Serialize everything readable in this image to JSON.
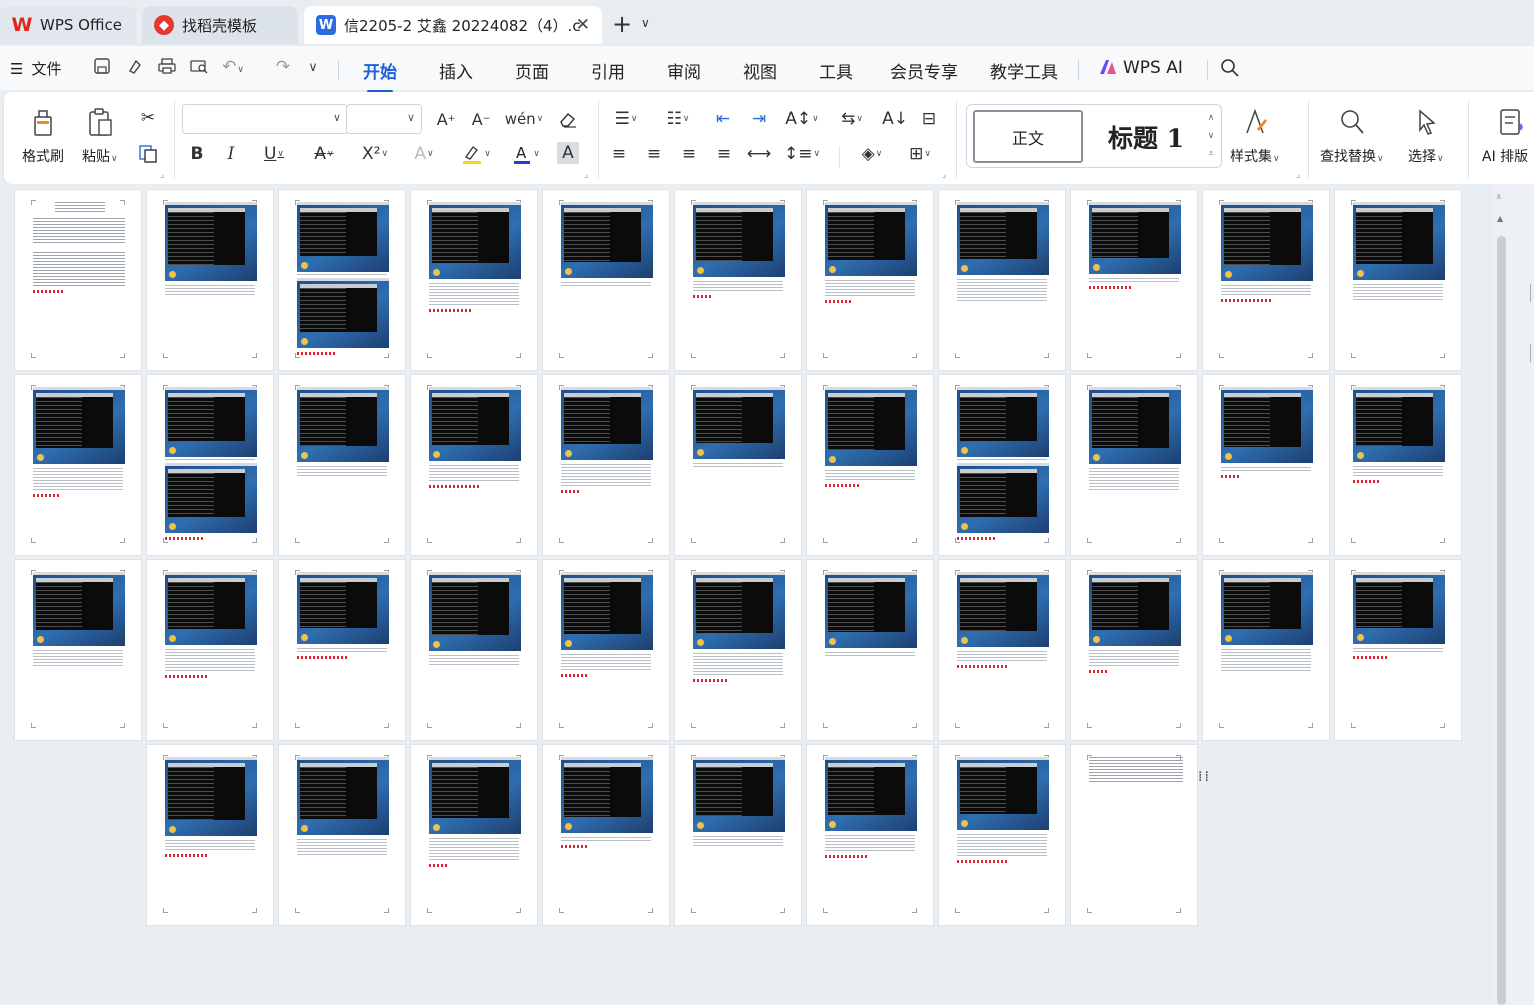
{
  "tabs": [
    {
      "label": "WPS Office"
    },
    {
      "label": "找稻壳模板"
    },
    {
      "label": "信2205-2 艾鑫 20224082（4）.c"
    }
  ],
  "menu": {
    "file": "文件",
    "tabs": [
      "开始",
      "插入",
      "页面",
      "引用",
      "审阅",
      "视图",
      "工具",
      "会员专享",
      "教学工具",
      "WPS AI"
    ],
    "active_tab": "开始"
  },
  "ribbon": {
    "format_painter": "格式刷",
    "paste": "粘贴",
    "font_name": "",
    "font_size": "",
    "style_normal": "正文",
    "style_heading": "标题 1",
    "style_set": "样式集",
    "find_replace": "查找替换",
    "select": "选择",
    "ai_layout": "AI 排版"
  },
  "colors": {
    "accent": "#1e5fd8",
    "wps_red": "#e1251b",
    "highlight_yellow": "#f5d90a",
    "font_color_blue": "#1b3fd1"
  },
  "document": {
    "page_count": 41
  }
}
